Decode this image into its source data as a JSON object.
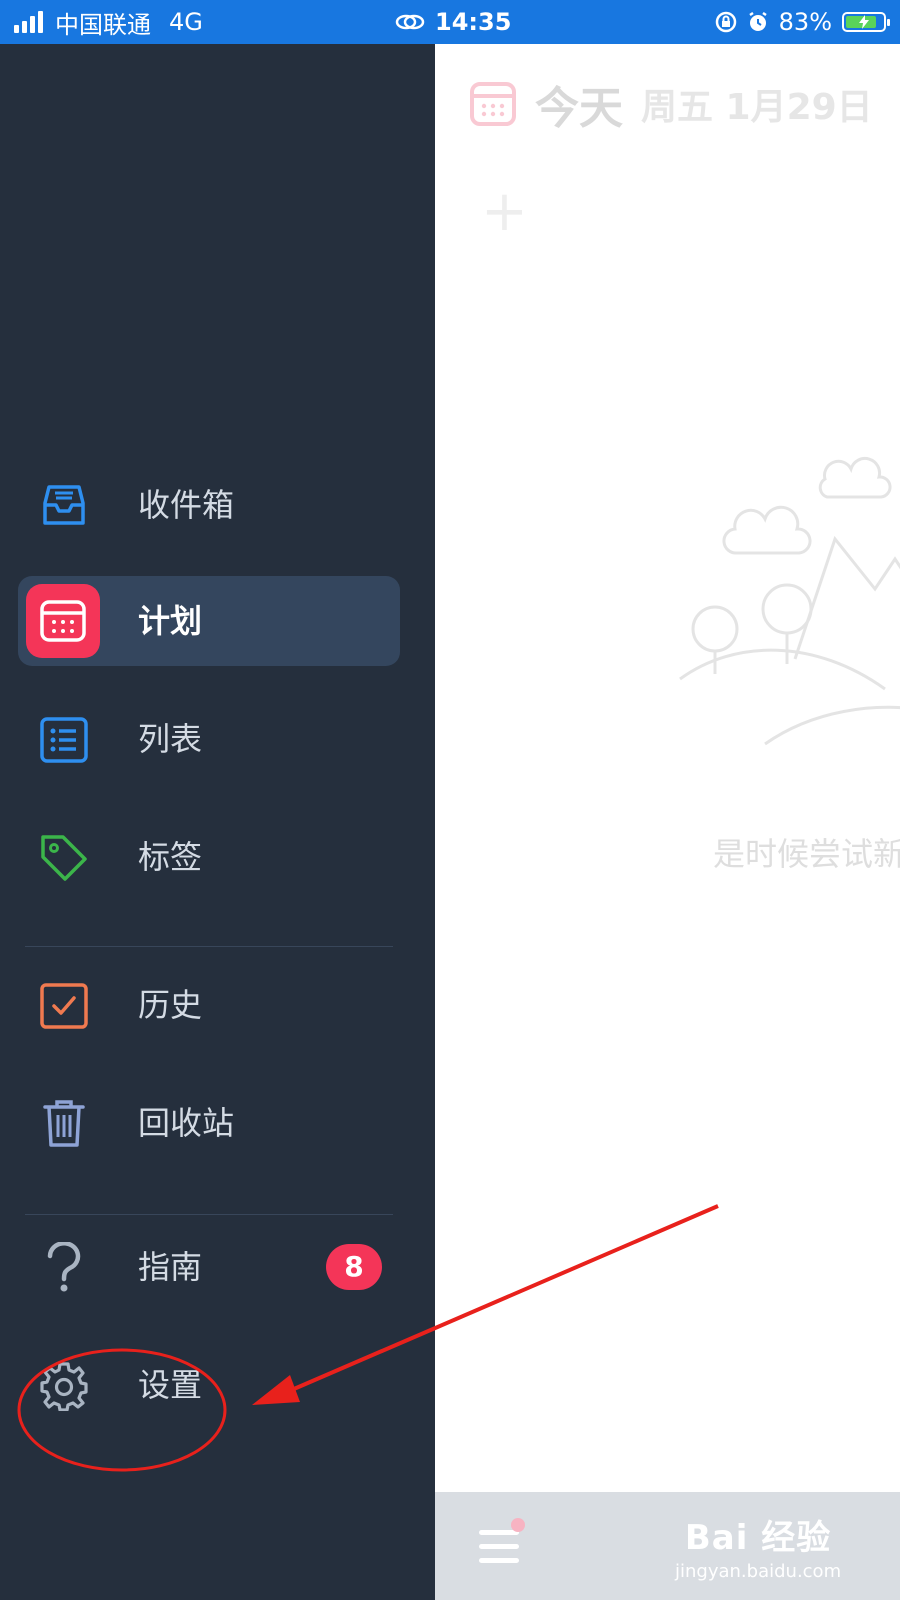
{
  "status_bar": {
    "carrier": "中国联通",
    "network": "4G",
    "time": "14:35",
    "battery": "83%",
    "battery_level": 0.83,
    "colors": {
      "background": "#1877e0",
      "battery_fill": "#5ad35a"
    }
  },
  "drawer": {
    "background": "#252f3d",
    "active_item_background": "#34465e",
    "items": [
      {
        "label": "收件箱",
        "icon": "inbox-icon",
        "color": "#2e8ff0"
      },
      {
        "label": "计划",
        "icon": "calendar-icon",
        "color": "#f43558",
        "active": true
      },
      {
        "label": "列表",
        "icon": "list-icon",
        "color": "#2e8ff0"
      },
      {
        "label": "标签",
        "icon": "tag-icon",
        "color": "#3bb54a"
      },
      {
        "label": "历史",
        "icon": "history-check-icon",
        "color": "#f07a50"
      },
      {
        "label": "回收站",
        "icon": "trash-icon",
        "color": "#8ea3d6"
      },
      {
        "label": "指南",
        "icon": "question-icon",
        "color": "#a9b4c2",
        "badge": "8"
      },
      {
        "label": "设置",
        "icon": "gear-icon",
        "color": "#a9b4c2"
      }
    ]
  },
  "main": {
    "title": "今天",
    "date": "周五 1月29日",
    "empty_text": "是时候尝试新"
  },
  "bottom_bar": {
    "menu_icon": "hamburger-menu-icon",
    "watermark_main": "Bai 经验",
    "watermark_sub": "jingyan.baidu.com"
  },
  "annotation": {
    "color": "#e8211c",
    "target": "设置"
  }
}
